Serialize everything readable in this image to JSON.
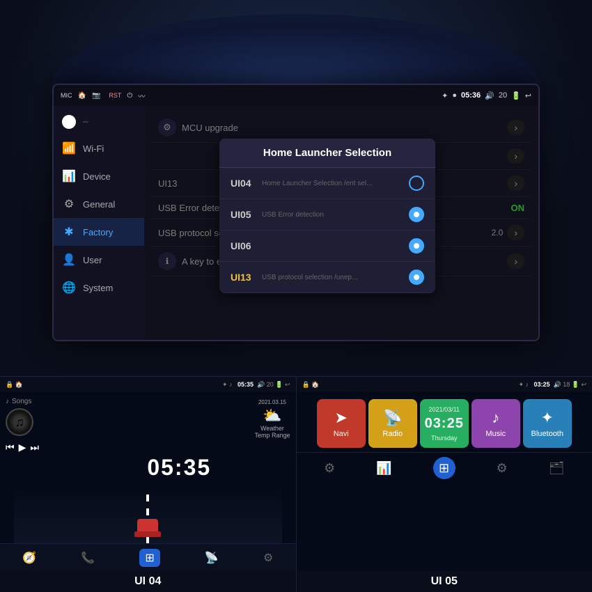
{
  "app": {
    "title": "Car Head Unit UI",
    "bg_color": "#0a0e1a"
  },
  "main_screen": {
    "status_bar": {
      "left_icons": [
        "MIC",
        "🏠",
        "📷"
      ],
      "rst_label": "RST",
      "time": "05:36",
      "battery": "20",
      "back_icon": "↩"
    },
    "sidebar": {
      "items": [
        {
          "id": "wifi",
          "label": "Wi-Fi",
          "icon": "📶",
          "active": false
        },
        {
          "id": "device",
          "label": "Device",
          "icon": "📊",
          "active": false
        },
        {
          "id": "general",
          "label": "General",
          "icon": "⚙",
          "active": false
        },
        {
          "id": "factory",
          "label": "Factory",
          "icon": "✱",
          "active": true
        },
        {
          "id": "user",
          "label": "User",
          "icon": "👤",
          "active": false
        },
        {
          "id": "system",
          "label": "System",
          "icon": "🌐",
          "active": false
        }
      ]
    },
    "settings_rows": [
      {
        "id": "mcu",
        "label": "MCU upgrade",
        "control": "chevron",
        "icon": "⚙"
      },
      {
        "id": "row2",
        "label": "",
        "control": "chevron",
        "icon": ""
      },
      {
        "id": "row3",
        "label": "UI13",
        "control": "chevron",
        "icon": ""
      },
      {
        "id": "usb_error",
        "label": "USB Error detection",
        "control": "on",
        "icon": ""
      },
      {
        "id": "usb_protocol",
        "label": "USB protocol selection /unep...",
        "sublabel": "2.0",
        "control": "chevron",
        "icon": ""
      },
      {
        "id": "export",
        "label": "A key to export",
        "control": "chevron",
        "icon": "ℹ"
      }
    ]
  },
  "popup": {
    "title": "Home Launcher Selection",
    "items": [
      {
        "id": "ui04",
        "label": "UI04",
        "sublabel": "Home Launcher Selection /ent sel...",
        "selected": false
      },
      {
        "id": "ui05",
        "label": "UI05",
        "sublabel": "USB Error detection",
        "selected": false
      },
      {
        "id": "ui06",
        "label": "UI06",
        "sublabel": "",
        "selected": false
      },
      {
        "id": "ui13",
        "label": "UI13",
        "sublabel": "USB protocol selection /unep...",
        "selected": true,
        "highlight": true
      }
    ]
  },
  "ui04_panel": {
    "label": "UI 04",
    "status": {
      "left": "🔒 🏠",
      "bluetooth": "🎵",
      "time": "05:35",
      "battery": "20",
      "back": "↩"
    },
    "music": {
      "songs_label": "Songs",
      "controls": [
        "⏮",
        "▶",
        "⏭"
      ]
    },
    "clock": "05:35",
    "weather": {
      "icon": "⛅",
      "date": "2021.03.15",
      "label": "Weather",
      "sublabel": "Temp Range"
    },
    "navbar": [
      "🧭",
      "📞",
      "⊞",
      "📡",
      "⚙"
    ]
  },
  "ui05_panel": {
    "label": "UI 05",
    "status": {
      "left": "🔒 🏠",
      "bluetooth": "🎵",
      "time": "03:25",
      "battery": "18",
      "back": "↩"
    },
    "apps": [
      {
        "id": "navi",
        "label": "Navi",
        "icon": "➤",
        "color": "#c0392b"
      },
      {
        "id": "radio",
        "label": "Radio",
        "icon": "📡",
        "color": "#d4a017"
      },
      {
        "id": "clock",
        "label": "Thursday",
        "date": "2021/03/11",
        "time": "03:25",
        "color": "#27ae60"
      },
      {
        "id": "music",
        "label": "Music",
        "icon": "♪",
        "color": "#8e44ad"
      },
      {
        "id": "bluetooth",
        "label": "Bluetooth",
        "icon": "✦",
        "color": "#2980b9"
      }
    ],
    "bottom_nav": [
      "⚙",
      "📊",
      "⊞",
      "⚙",
      "🗂"
    ]
  }
}
